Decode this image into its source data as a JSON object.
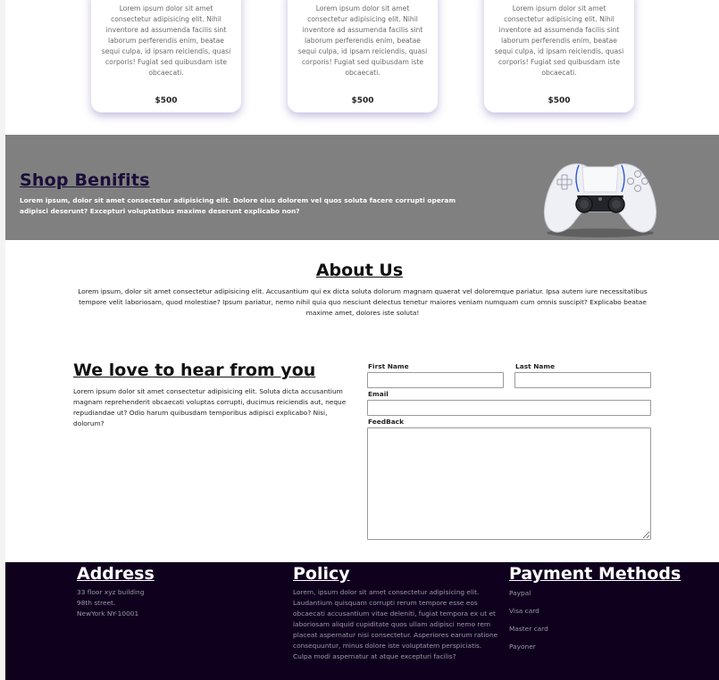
{
  "cards": [
    {
      "text": "Lorem ipsum dolor sit amet consectetur adipisicing elit. Nihil inventore ad assumenda facilis sint laborum perferendis enim, beatae sequi culpa, id ipsam reiciendis, quasi corporis! Fugiat sed quibusdam iste obcaecati.",
      "price": "$500"
    },
    {
      "text": "Lorem ipsum dolor sit amet consectetur adipisicing elit. Nihil inventore ad assumenda facilis sint laborum perferendis enim, beatae sequi culpa, id ipsam reiciendis, quasi corporis! Fugiat sed quibusdam iste obcaecati.",
      "price": "$500"
    },
    {
      "text": "Lorem ipsum dolor sit amet consectetur adipisicing elit. Nihil inventore ad assumenda facilis sint laborum perferendis enim, beatae sequi culpa, id ipsam reiciendis, quasi corporis! Fugiat sed quibusdam iste obcaecati.",
      "price": "$500"
    }
  ],
  "benefits": {
    "title": "Shop Benifits",
    "text": "Lorem ipsum, dolor sit amet consectetur adipisicing elit. Dolore eius dolorem vel quos soluta facere corrupti operam adipisci deserunt? Excepturi voluptatibus maxime deserunt explicabo non?",
    "bg_color": "#808080",
    "title_color": "#1a0d3a"
  },
  "about": {
    "title": "About Us",
    "text": "Lorem ipsum, dolor sit amet consectetur adipisicing elit. Accusantium qui ex dicta soluta dolorum magnam quaerat vel doloremque pariatur. Ipsa autem iure necessitatibus tempore velit laboriosam, quod molestiae? Ipsum pariatur, nemo nihil quia quo nesciunt delectus tenetur maiores veniam numquam cum omnis suscipit? Explicabo beatae maxime amet, dolores iste soluta!"
  },
  "contact": {
    "title": "We love to hear from you",
    "text": "Lorem ipsum dolor sit amet consectetur adipisicing elit. Soluta dicta accusantium magnam reprehenderit obcaecati voluptas corrupti, ducimus reiciendis aut, neque repudiandae ut? Odio harum quibusdam temporibus adipisci explicabo? Nisi, dolorum?",
    "first_name_label": "First Name",
    "last_name_label": "Last Name",
    "email_label": "Email",
    "feedback_label": "FeedBack"
  },
  "footer": {
    "bg_color": "#0f001e",
    "address": {
      "title": "Address",
      "lines": [
        "33 floor xyz building",
        "98th street.",
        "NewYork NY-10001"
      ]
    },
    "policy": {
      "title": "Policy",
      "text": "Lorem, ipsum dolor sit amet consectetur adipisicing elit. Laudantium quisquam corrupti rerum tempore esse eos obcaecati accusantium vitae deleniti, fugiat tempora ex ut et laboriosam aliquid cupiditate quos ullam adipisci nemo rem placeat aspernatur nisi consectetur. Asperiores earum ratione consequuntur, minus dolore iste voluptatem perspiciatis. Culpa modi aspernatur at atque excepturi facilis?"
    },
    "payment": {
      "title": "Payment Methods",
      "items": [
        "Paypal",
        "Visa card",
        "Master card",
        "Payoner"
      ]
    }
  }
}
